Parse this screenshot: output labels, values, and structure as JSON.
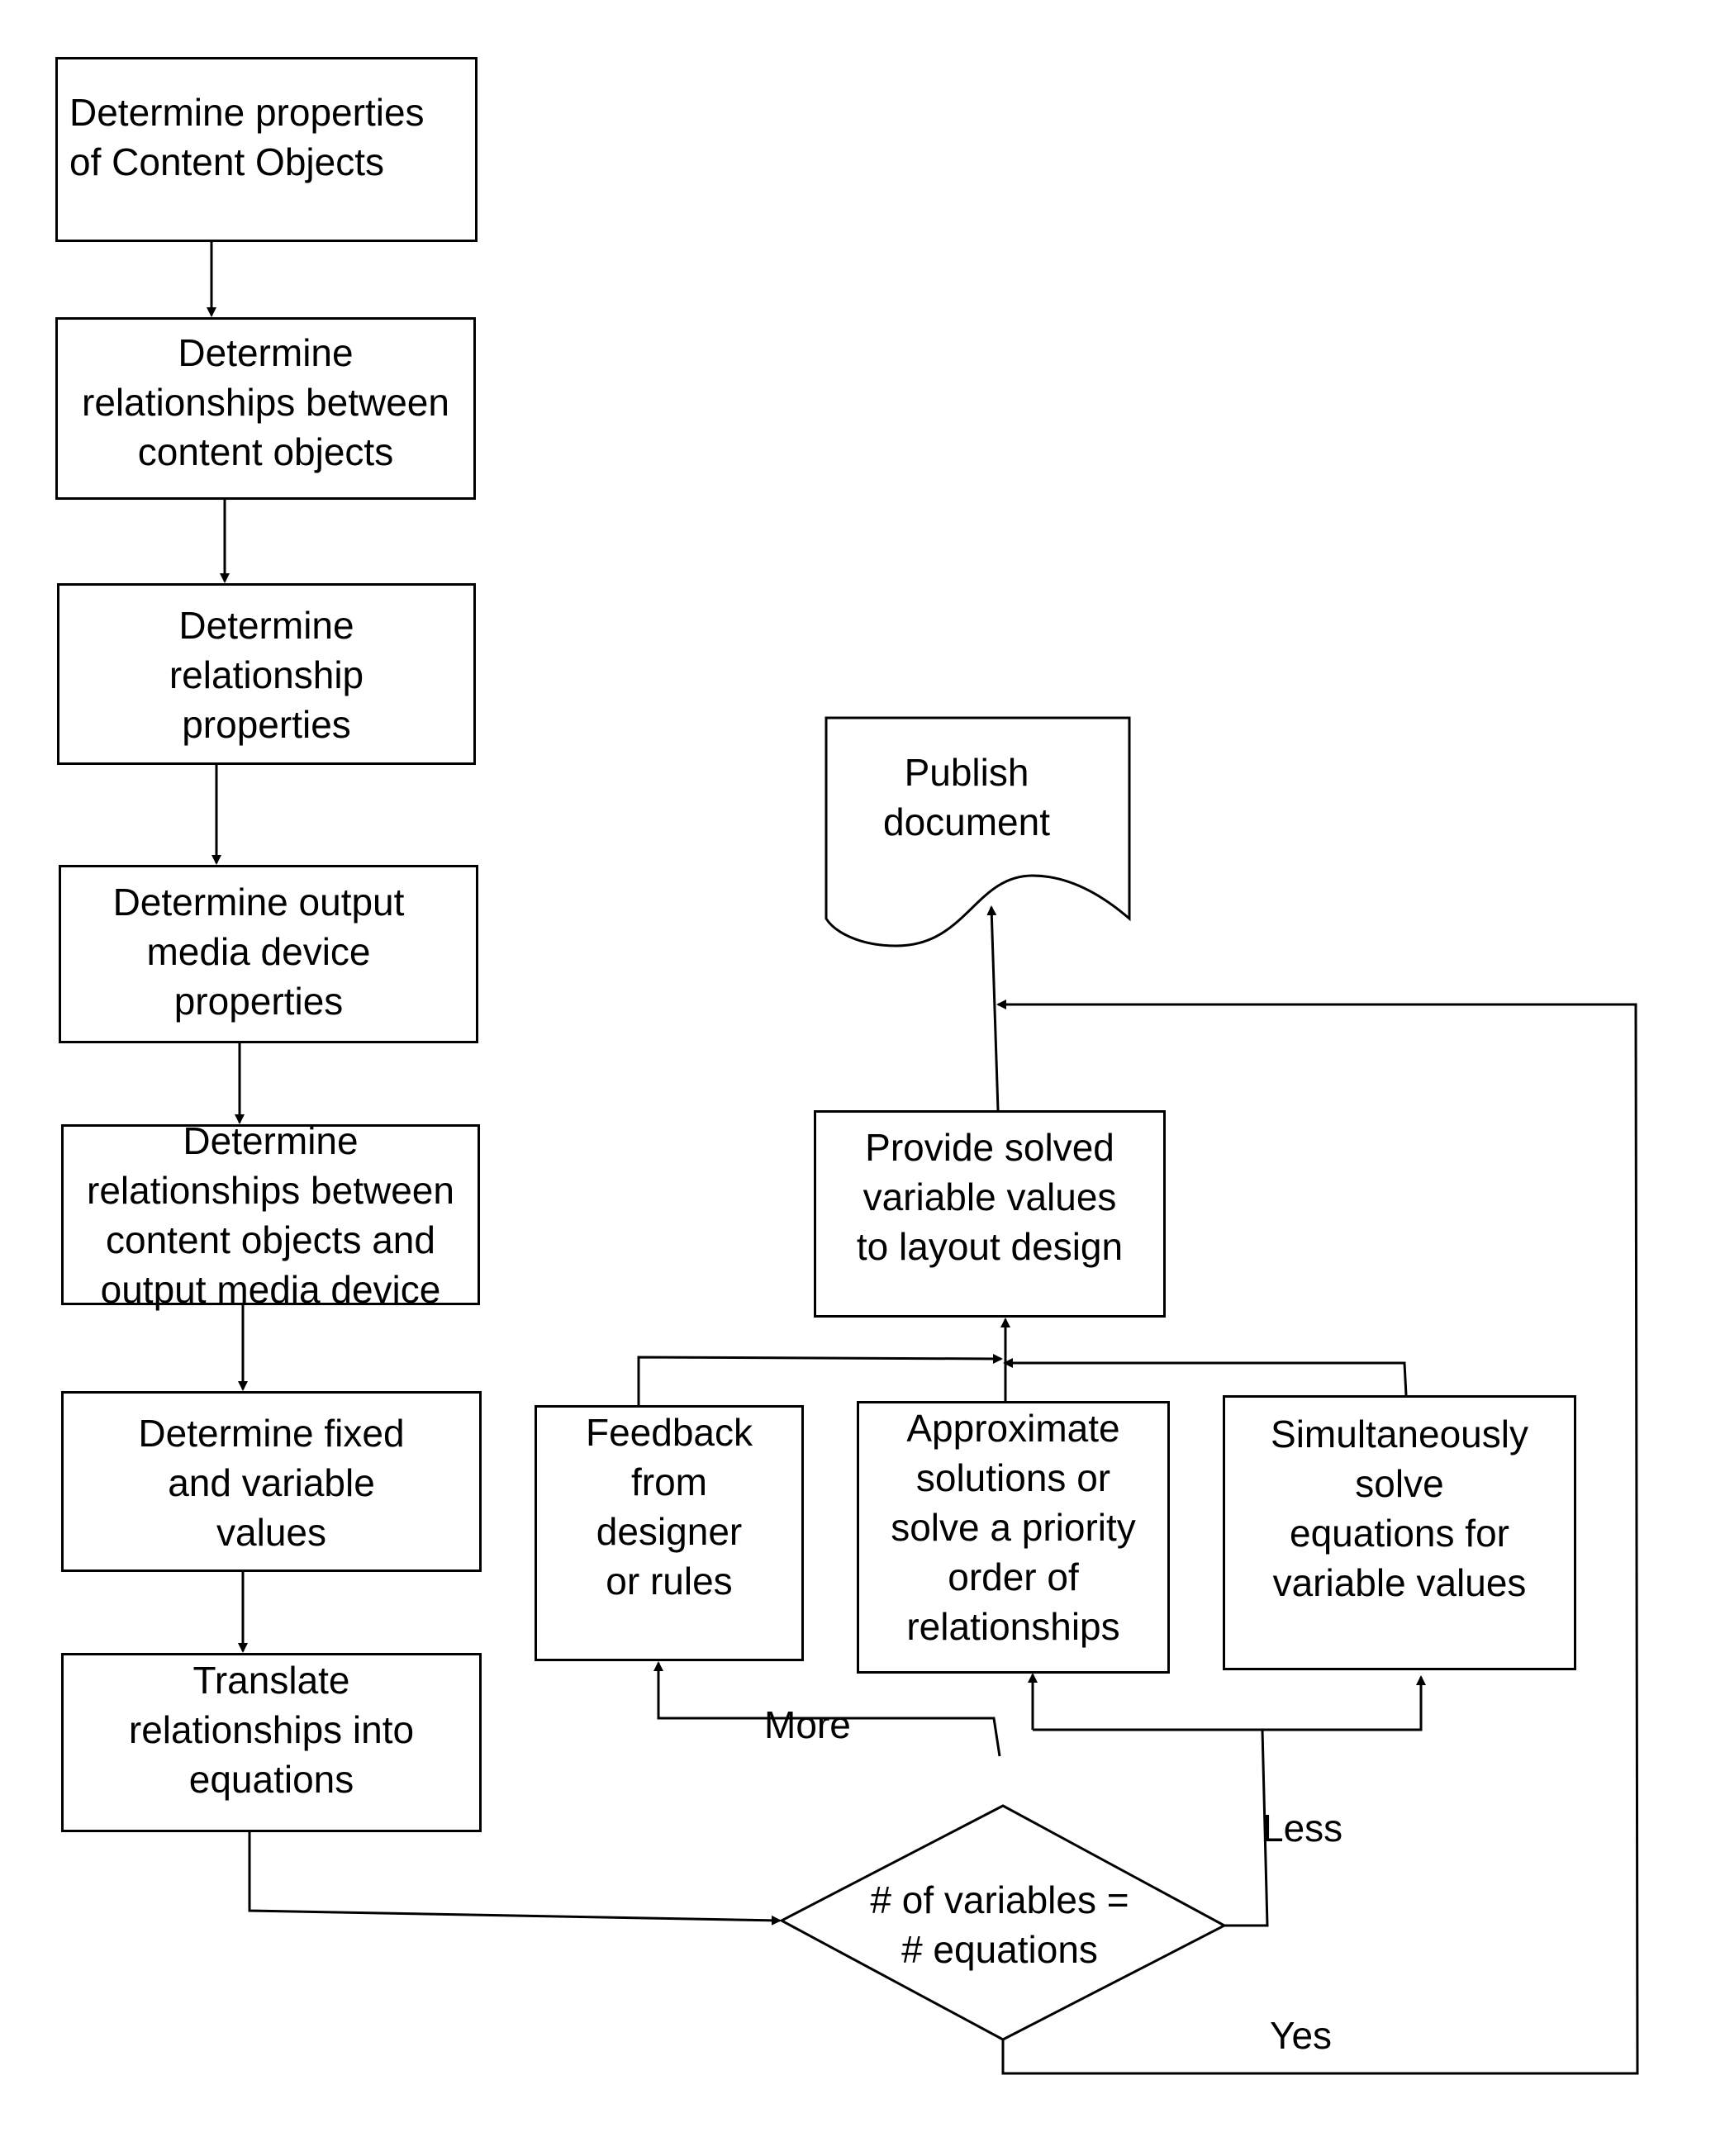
{
  "left_column": [
    {
      "id": "step1",
      "lines": [
        "Determine properties",
        "of Content Objects"
      ]
    },
    {
      "id": "step2",
      "lines": [
        "Determine",
        "relationships between",
        "content objects"
      ]
    },
    {
      "id": "step3",
      "lines": [
        "Determine",
        "relationship",
        "properties"
      ]
    },
    {
      "id": "step4",
      "lines": [
        "Determine output",
        "media device",
        "properties"
      ]
    },
    {
      "id": "step5",
      "lines": [
        "Determine",
        "relationships between",
        "content objects and",
        "output media device"
      ]
    },
    {
      "id": "step6",
      "lines": [
        "Determine fixed",
        "and variable",
        "values"
      ]
    },
    {
      "id": "step7",
      "lines": [
        "Translate",
        "relationships into",
        "equations"
      ]
    }
  ],
  "decision": {
    "lines": [
      "# of variables =",
      "# equations"
    ]
  },
  "branches": {
    "more": "More",
    "less": "Less",
    "yes": "Yes"
  },
  "solvers": [
    {
      "id": "feedback",
      "lines": [
        "Feedback",
        "from",
        "designer",
        "or rules"
      ]
    },
    {
      "id": "approximate",
      "lines": [
        "Approximate",
        "solutions or",
        "solve a priority",
        "order of",
        "relationships"
      ]
    },
    {
      "id": "simultaneous",
      "lines": [
        "Simultaneously",
        "solve",
        "equations for",
        "variable values"
      ]
    }
  ],
  "provide": {
    "lines": [
      "Provide solved",
      "variable values",
      "to layout design"
    ]
  },
  "publish": {
    "lines": [
      "Publish",
      "document"
    ]
  }
}
